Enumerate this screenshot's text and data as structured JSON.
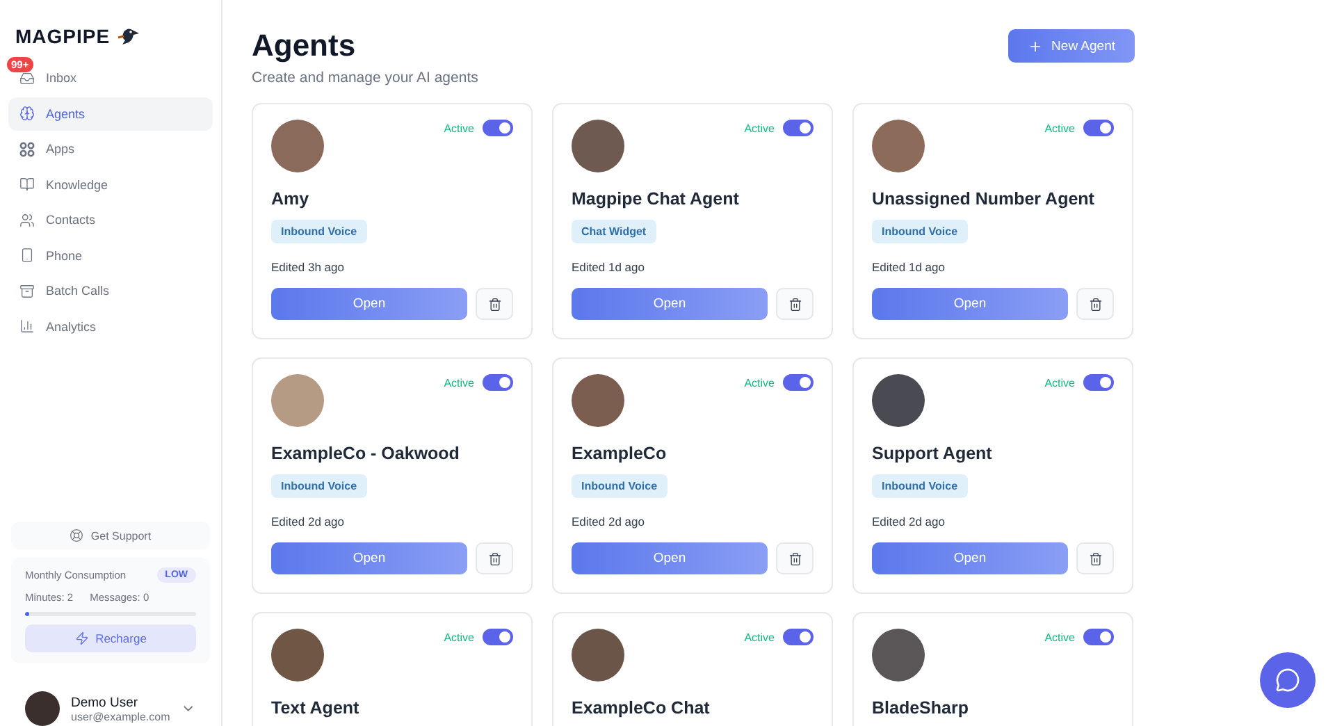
{
  "brand": {
    "name": "MAGPIPE"
  },
  "nav": [
    {
      "label": "Inbox",
      "kind": "inbox",
      "selected": false,
      "badge": "99+"
    },
    {
      "label": "Agents",
      "kind": "agents",
      "selected": true
    },
    {
      "label": "Apps",
      "kind": "apps",
      "selected": false
    },
    {
      "label": "Knowledge",
      "kind": "knowledge",
      "selected": false
    },
    {
      "label": "Contacts",
      "kind": "contacts",
      "selected": false
    },
    {
      "label": "Phone",
      "kind": "phone",
      "selected": false
    },
    {
      "label": "Batch Calls",
      "kind": "batch",
      "selected": false
    },
    {
      "label": "Analytics",
      "kind": "analytics",
      "selected": false
    }
  ],
  "support": {
    "label": "Get Support"
  },
  "consumption": {
    "title": "Monthly Consumption",
    "badge": "LOW",
    "minutes": "Minutes: 2",
    "messages": "Messages: 0",
    "level": 0.02,
    "button": "Recharge"
  },
  "user": {
    "name": "Demo User",
    "email": "user@example.com"
  },
  "header": {
    "title": "Agents",
    "subtitle": "Create and manage your AI agents",
    "button": "New Agent"
  },
  "agents": [
    {
      "name": "Amy",
      "status": "Active",
      "active": true,
      "tag": "Inbound Voice",
      "edited": "Edited 3h ago",
      "open": "Open"
    },
    {
      "name": "Magpipe Chat Agent",
      "status": "Active",
      "active": true,
      "tag": "Chat Widget",
      "edited": "Edited 1d ago",
      "open": "Open"
    },
    {
      "name": "Unassigned Number Agent",
      "status": "Active",
      "active": true,
      "tag": "Inbound Voice",
      "edited": "Edited 1d ago",
      "open": "Open"
    },
    {
      "name": "ExampleCo - Oakwood",
      "status": "Active",
      "active": true,
      "tag": "Inbound Voice",
      "edited": "Edited 2d ago",
      "open": "Open"
    },
    {
      "name": "ExampleCo",
      "status": "Active",
      "active": true,
      "tag": "Inbound Voice",
      "edited": "Edited 2d ago",
      "open": "Open"
    },
    {
      "name": "Support Agent",
      "status": "Active",
      "active": true,
      "tag": "Inbound Voice",
      "edited": "Edited 2d ago",
      "open": "Open"
    },
    {
      "name": "Text Agent",
      "status": "Active",
      "active": true
    },
    {
      "name": "ExampleCo Chat",
      "status": "Active",
      "active": true
    },
    {
      "name": "BladeSharp",
      "status": "Active",
      "active": true
    }
  ]
}
